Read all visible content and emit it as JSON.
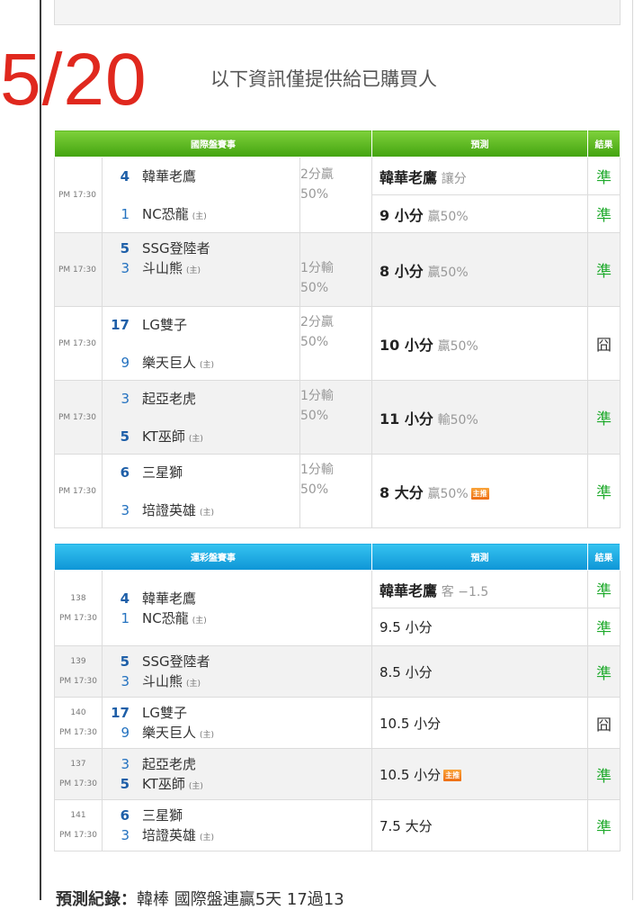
{
  "date": "5/20",
  "notice": "以下資訊僅提供給已購買人",
  "home_tag": "(主)",
  "hot_tag": "主推",
  "intl": {
    "headers": {
      "match": "國際盤賽事",
      "prediction": "預測",
      "result": "結果"
    },
    "games": [
      {
        "time": "PM 17:30",
        "away": {
          "rank": "4",
          "name": "韓華老鷹"
        },
        "home": {
          "rank": "1",
          "name": "NC恐龍"
        },
        "odds": [
          "2分贏",
          "50%"
        ],
        "pred1": {
          "main": "韓華老鷹",
          "sub": "讓分"
        },
        "result1": "準",
        "pred2": {
          "main": "9 小分",
          "sub": "贏50%"
        },
        "result2": "準"
      },
      {
        "time": "PM 17:30",
        "away": {
          "rank": "5",
          "name": "SSG登陸者"
        },
        "home": {
          "rank": "3",
          "name": "斗山熊"
        },
        "odds": [
          "1分輸",
          "50%"
        ],
        "pred": {
          "main": "8 小分",
          "sub": "贏50%"
        },
        "result": "準"
      },
      {
        "time": "PM 17:30",
        "away": {
          "rank": "17",
          "name": "LG雙子"
        },
        "home": {
          "rank": "9",
          "name": "樂天巨人"
        },
        "odds": [
          "2分贏",
          "50%"
        ],
        "pred": {
          "main": "10 小分",
          "sub": "贏50%"
        },
        "result": "囧"
      },
      {
        "time": "PM 17:30",
        "away": {
          "rank": "3",
          "name": "起亞老虎"
        },
        "home": {
          "rank": "5",
          "name": "KT巫師"
        },
        "odds": [
          "1分輸",
          "50%"
        ],
        "pred": {
          "main": "11 小分",
          "sub": "輸50%"
        },
        "result": "準"
      },
      {
        "time": "PM 17:30",
        "away": {
          "rank": "6",
          "name": "三星獅"
        },
        "home": {
          "rank": "3",
          "name": "培證英雄"
        },
        "odds": [
          "1分輸",
          "50%"
        ],
        "pred": {
          "main": "8 大分",
          "sub": "贏50%"
        },
        "result": "準"
      }
    ]
  },
  "lottery": {
    "headers": {
      "match": "運彩盤賽事",
      "prediction": "預測",
      "result": "結果"
    },
    "games": [
      {
        "id": "138",
        "time": "PM 17:30",
        "away": {
          "rank": "4",
          "name": "韓華老鷹"
        },
        "home": {
          "rank": "1",
          "name": "NC恐龍"
        },
        "pred1": {
          "main": "韓華老鷹",
          "sub": "客 −1.5"
        },
        "result1": "準",
        "pred2": "9.5 小分",
        "result2": "準"
      },
      {
        "id": "139",
        "time": "PM 17:30",
        "away": {
          "rank": "5",
          "name": "SSG登陸者"
        },
        "home": {
          "rank": "3",
          "name": "斗山熊"
        },
        "pred": "8.5 小分",
        "result": "準"
      },
      {
        "id": "140",
        "time": "PM 17:30",
        "away": {
          "rank": "17",
          "name": "LG雙子"
        },
        "home": {
          "rank": "9",
          "name": "樂天巨人"
        },
        "pred": "10.5 小分",
        "result": "囧"
      },
      {
        "id": "137",
        "time": "PM 17:30",
        "away": {
          "rank": "3",
          "name": "起亞老虎"
        },
        "home": {
          "rank": "5",
          "name": "KT巫師"
        },
        "pred": "10.5 小分",
        "result": "準"
      },
      {
        "id": "141",
        "time": "PM 17:30",
        "away": {
          "rank": "6",
          "name": "三星獅"
        },
        "home": {
          "rank": "3",
          "name": "培證英雄"
        },
        "pred": "7.5 大分",
        "result": "準"
      }
    ]
  },
  "footer": {
    "label": "預測紀錄：",
    "text": "韓棒 國際盤連贏5天 17過13"
  },
  "colors": {
    "date": "#e0281e",
    "win": "#1faa2c",
    "intl_header": "#43a30f",
    "lottery_header": "#0e95d6"
  }
}
